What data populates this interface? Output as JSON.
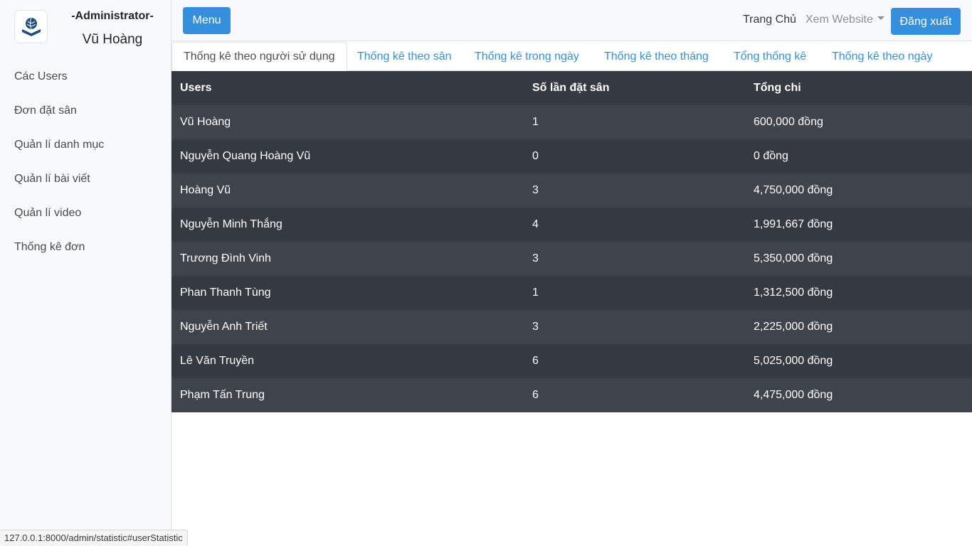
{
  "sidebar": {
    "logo_icon": "sports-ball-book-icon",
    "role": "-Administrator-",
    "user_name": "Vũ Hoàng",
    "items": [
      {
        "label": "Các Users"
      },
      {
        "label": "Đơn đặt sân"
      },
      {
        "label": "Quản lí danh mục"
      },
      {
        "label": "Quản lí bài viết"
      },
      {
        "label": "Quản lí video"
      },
      {
        "label": "Thống kê đơn"
      }
    ]
  },
  "topbar": {
    "menu_label": "Menu",
    "home_label": "Trang Chủ",
    "website_label": "Xem Website",
    "logout_label": "Đăng xuất"
  },
  "tabs": [
    {
      "label": "Thống kê theo người sử dụng",
      "active": true
    },
    {
      "label": "Thống kê theo sân",
      "active": false
    },
    {
      "label": "Thống kê trong ngày",
      "active": false
    },
    {
      "label": "Thống kê theo tháng",
      "active": false
    },
    {
      "label": "Tổng thống kê",
      "active": false
    },
    {
      "label": "Thống kê theo ngày",
      "active": false
    }
  ],
  "table": {
    "headers": [
      "Users",
      "Số lần đặt sân",
      "Tổng chi"
    ],
    "rows": [
      [
        "Vũ Hoàng",
        "1",
        "600,000 đồng"
      ],
      [
        "Nguyễn Quang Hoàng Vũ",
        "0",
        "0 đồng"
      ],
      [
        "Hoàng Vũ",
        "3",
        "4,750,000 đồng"
      ],
      [
        "Nguyễn Minh Thắng",
        "4",
        "1,991,667 đồng"
      ],
      [
        "Trương Đình Vinh",
        "3",
        "5,350,000 đồng"
      ],
      [
        "Phan Thanh Tùng",
        "1",
        "1,312,500 đồng"
      ],
      [
        "Nguyễn Anh Triết",
        "3",
        "2,225,000 đồng"
      ],
      [
        "Lê Văn Truyền",
        "6",
        "5,025,000 đồng"
      ],
      [
        "Phạm Tấn Trung",
        "6",
        "4,475,000 đồng"
      ]
    ]
  },
  "status_bar": {
    "url": "127.0.0.1:8000/admin/statistic#userStatistic"
  },
  "colors": {
    "primary": "#3490dc",
    "table_dark": "#343a40",
    "table_stripe": "#3e444a",
    "sidebar_bg": "#f8f9fa"
  }
}
